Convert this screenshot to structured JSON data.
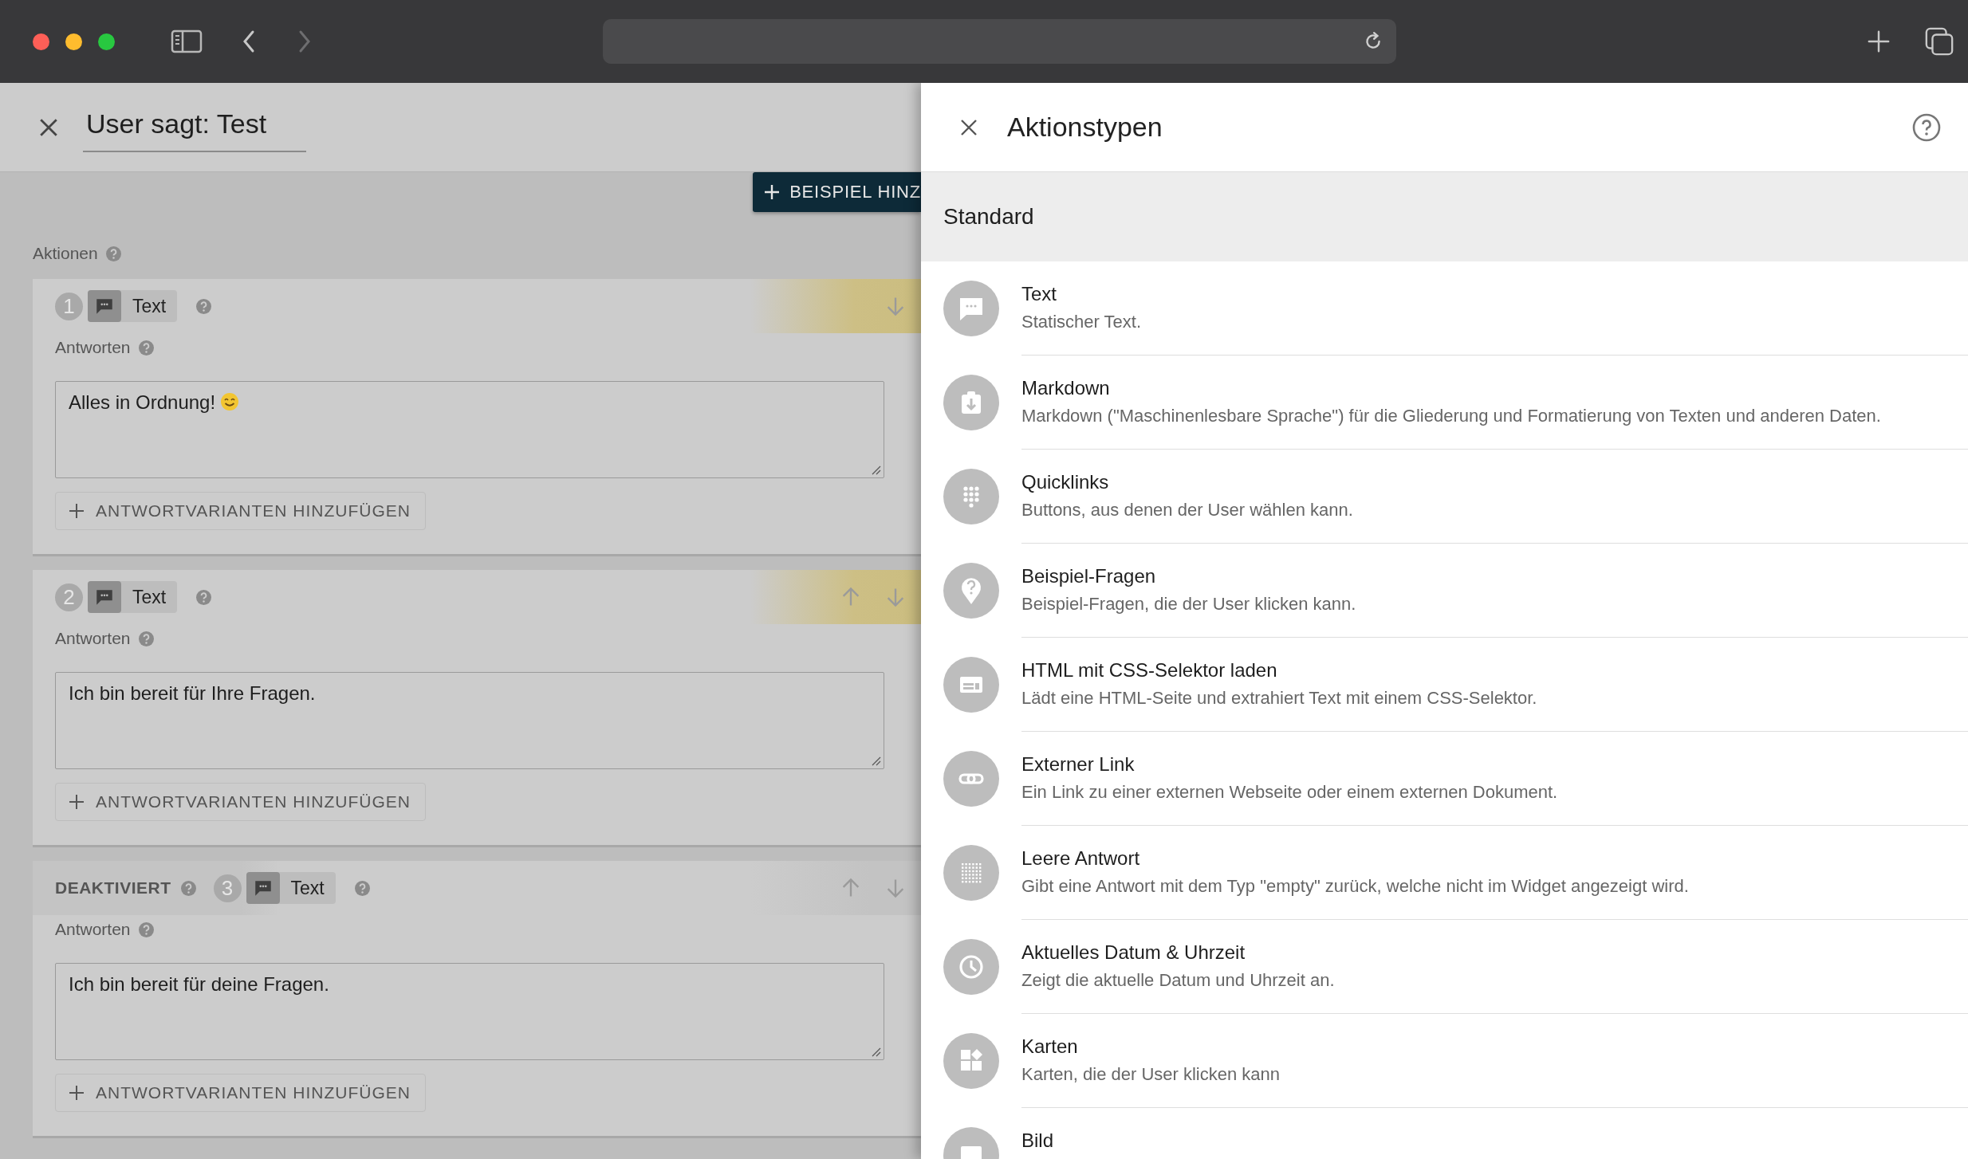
{
  "editor": {
    "title": "User sagt: Test",
    "add_example_button": "BEISPIEL HINZ",
    "actions_label": "Aktionen",
    "actions": [
      {
        "number": "1",
        "type_label": "Text",
        "disabled": false,
        "move_up": false,
        "move_down": true,
        "responses_label": "Antworten",
        "response": "Alles in Ordnung!",
        "kind": "emoji",
        "add_variants_button": "ANTWORTVARIANTEN HINZUFÜGEN"
      },
      {
        "number": "2",
        "type_label": "Text",
        "disabled": false,
        "move_up": true,
        "move_down": true,
        "responses_label": "Antworten",
        "response": "Ich bin bereit für Ihre Fragen.",
        "kind": "plain",
        "add_variants_button": "ANTWORTVARIANTEN HINZUFÜGEN"
      },
      {
        "number": "3",
        "type_label": "Text",
        "disabled": true,
        "disabled_label": "DEAKTIVIERT",
        "move_up": true,
        "move_down": true,
        "responses_label": "Antworten",
        "response": "Ich bin bereit für deine Fragen.",
        "kind": "plain",
        "add_variants_button": "ANTWORTVARIANTEN HINZUFÜGEN"
      }
    ]
  },
  "panel": {
    "title": "Aktionstypen",
    "section": "Standard",
    "items": [
      {
        "title": "Text",
        "description": "Statischer Text."
      },
      {
        "title": "Markdown",
        "description": "Markdown (\"Maschinenlesbare Sprache\") für die Gliederung und Formatierung von Texten und anderen Daten."
      },
      {
        "title": "Quicklinks",
        "description": "Buttons, aus denen der User wählen kann."
      },
      {
        "title": "Beispiel-Fragen",
        "description": "Beispiel-Fragen, die der User klicken kann."
      },
      {
        "title": "HTML mit CSS-Selektor laden",
        "description": "Lädt eine HTML-Seite und extrahiert Text mit einem CSS-Selektor."
      },
      {
        "title": "Externer Link",
        "description": "Ein Link zu einer externen Webseite oder einem externen Dokument."
      },
      {
        "title": "Leere Antwort",
        "description": "Gibt eine Antwort mit dem Typ \"empty\" zurück, welche nicht im Widget angezeigt wird."
      },
      {
        "title": "Aktuelles Datum & Uhrzeit",
        "description": "Zeigt die aktuelle Datum und Uhrzeit an."
      },
      {
        "title": "Karten",
        "description": "Karten, die der User klicken kann"
      },
      {
        "title": "Bild"
      }
    ]
  }
}
